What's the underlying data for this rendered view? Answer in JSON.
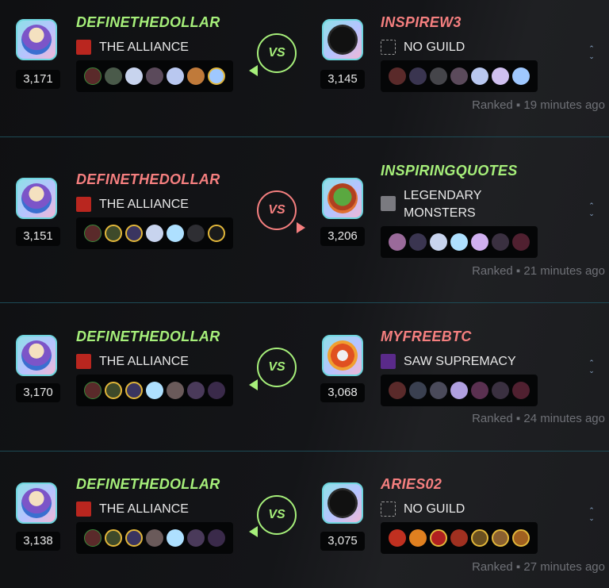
{
  "colors": {
    "winner": "#a6ef7a",
    "loser": "#f57f7f",
    "divider": "#1d4a55"
  },
  "battles": [
    {
      "left": {
        "name": "DEFINETHEDOLLAR",
        "result": "win",
        "guild": "THE ALLIANCE",
        "guild_icon": "alliance-banner-icon",
        "rating": "3,171",
        "avatar": "wizard-avatar"
      },
      "right": {
        "name": "INSPIREW3",
        "result": "lose",
        "guild": "NO GUILD",
        "guild_icon": "no-guild-icon",
        "rating": "3,145",
        "avatar": "fangs-avatar"
      },
      "vs": "VS",
      "meta": "Ranked ▪ 19 minutes ago"
    },
    {
      "left": {
        "name": "DEFINETHEDOLLAR",
        "result": "lose",
        "guild": "THE ALLIANCE",
        "guild_icon": "alliance-banner-icon",
        "rating": "3,151",
        "avatar": "wizard-avatar"
      },
      "right": {
        "name": "INSPIRINGQUOTES",
        "result": "win",
        "guild": "LEGENDARY MONSTERS",
        "guild_line1": "LEGENDARY",
        "guild_line2": "MONSTERS",
        "guild_icon": "reaper-guild-icon",
        "rating": "3,206",
        "avatar": "orc-avatar"
      },
      "vs": "VS",
      "meta": "Ranked ▪ 21 minutes ago"
    },
    {
      "left": {
        "name": "DEFINETHEDOLLAR",
        "result": "win",
        "guild": "THE ALLIANCE",
        "guild_icon": "alliance-banner-icon",
        "rating": "3,170",
        "avatar": "wizard-avatar"
      },
      "right": {
        "name": "MYFREEBTC",
        "result": "lose",
        "guild": "SAW SUPREMACY",
        "guild_icon": "lightning-guild-icon",
        "rating": "3,068",
        "avatar": "flame-skull-avatar"
      },
      "vs": "VS",
      "meta": "Ranked ▪ 24 minutes ago"
    },
    {
      "left": {
        "name": "DEFINETHEDOLLAR",
        "result": "win",
        "guild": "THE ALLIANCE",
        "guild_icon": "alliance-banner-icon",
        "rating": "3,138",
        "avatar": "wizard-avatar"
      },
      "right": {
        "name": "ARIES02",
        "result": "lose",
        "guild": "NO GUILD",
        "guild_icon": "no-guild-icon",
        "rating": "3,075",
        "avatar": "fangs-avatar"
      },
      "vs": "VS",
      "meta": "Ranked ▪ 27 minutes ago"
    }
  ]
}
